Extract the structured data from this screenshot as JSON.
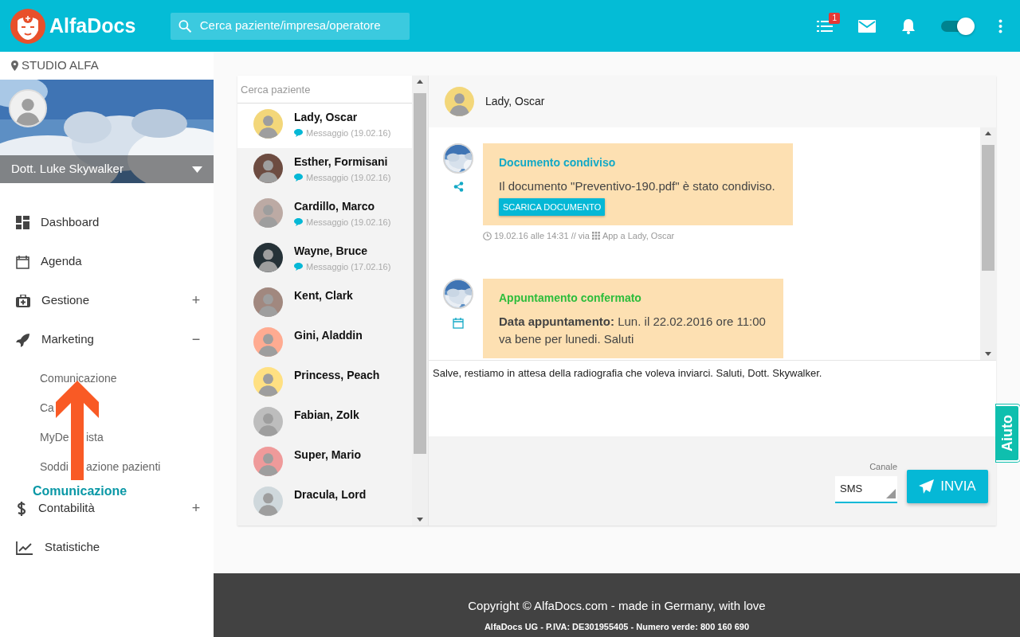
{
  "header": {
    "brand": "AlfaDocs",
    "search": {
      "placeholder": "Cerca paziente/impresa/operatore"
    },
    "tasks_badge": "1",
    "toggle": {
      "on": true
    }
  },
  "sidebar": {
    "location": "STUDIO ALFA",
    "user": "Dott. Luke Skywalker",
    "items": [
      {
        "label": "Dashboard"
      },
      {
        "label": "Agenda"
      },
      {
        "label": "Gestione",
        "sign": "+",
        "expanded": false
      },
      {
        "label": "Marketing",
        "sign": "−",
        "expanded": true,
        "children": [
          {
            "parts": [
              "Comunicazione"
            ]
          },
          {
            "parts": [
              "Ca"
            ]
          },
          {
            "parts": [
              "MyDe",
              "ista"
            ]
          },
          {
            "parts": [
              "Soddi",
              "azione pazienti"
            ]
          }
        ]
      },
      {
        "label": "Contabilità",
        "sign": "+",
        "expanded": false
      },
      {
        "label": "Statistiche"
      }
    ]
  },
  "annotation": {
    "label": "Comunicazione"
  },
  "patients": {
    "search": {
      "placeholder": "Cerca paziente"
    },
    "items": [
      {
        "name": "Lady, Oscar",
        "meta": "Messaggio (19.02.16)",
        "selected": true
      },
      {
        "name": "Esther, Formisani",
        "meta": "Messaggio (19.02.16)",
        "selected": false
      },
      {
        "name": "Cardillo, Marco",
        "meta": "Messaggio (19.02.16)",
        "selected": false
      },
      {
        "name": "Wayne, Bruce",
        "meta": "Messaggio (17.02.16)",
        "selected": false
      },
      {
        "name": "Kent, Clark",
        "selected": false
      },
      {
        "name": "Gini, Aladdin",
        "selected": false
      },
      {
        "name": "Princess, Peach",
        "selected": false
      },
      {
        "name": "Fabian, Zolk",
        "selected": false
      },
      {
        "name": "Super, Mario",
        "selected": false
      },
      {
        "name": "Dracula, Lord",
        "selected": false
      }
    ]
  },
  "conversation": {
    "patient": "Lady, Oscar",
    "messages": [
      {
        "kind": "document",
        "title": "Documento condiviso",
        "lines": [
          "Il documento \"Preventivo-190.pdf\" è stato condiviso."
        ],
        "button": "SCARICA DOCUMENTO",
        "time": "19.02.16 alle 14:31 // via",
        "source": "App a Lady, Oscar"
      },
      {
        "kind": "appointment",
        "title": "Appuntamento confermato",
        "lines": [
          "**Data appuntamento:** Lun. il 22.02.2016 ore 11:00",
          "va bene per lunedi. Saluti"
        ]
      }
    ],
    "reply": {
      "value": "Salve, restiamo in attesa della radiografia che voleva inviarci. Saluti, Dott. Skywalker."
    },
    "channel": {
      "label": "Canale",
      "value": "SMS"
    },
    "send": "INVIA"
  },
  "help": "Aiuto",
  "footer": {
    "copyright": "Copyright © AlfaDocs.com - made in Germany, with love",
    "legal": "AlfaDocs UG - P.IVA: DE301955405 - Numero verde: 800 160 690"
  }
}
